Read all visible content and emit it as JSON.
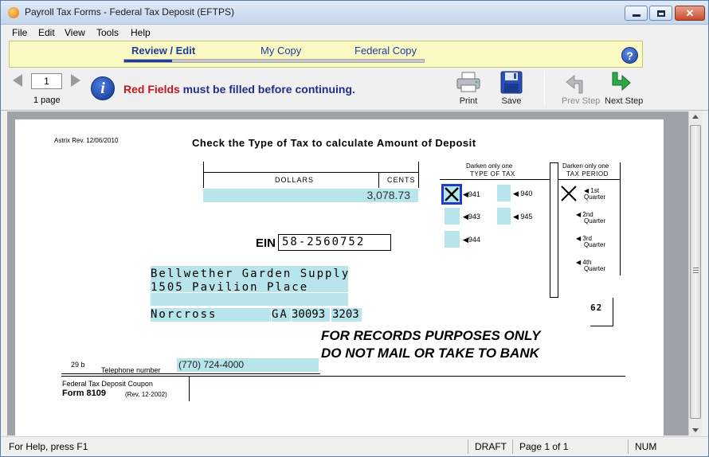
{
  "window": {
    "title": "Payroll Tax Forms - Federal Tax Deposit (EFTPS)",
    "minimize_glyph": "",
    "maximize_glyph": "",
    "close_glyph": "✕"
  },
  "menu": [
    "File",
    "Edit",
    "View",
    "Tools",
    "Help"
  ],
  "banner": {
    "tabs": [
      "Review / Edit",
      "My Copy",
      "Federal Copy"
    ],
    "active_tab": 0,
    "progress_fraction": 0.16,
    "help_glyph": "?"
  },
  "toolbar": {
    "page_number": "1",
    "page_count": "1 page",
    "message_red": "Red Fields",
    "message_rest": " must be filled before continuing.",
    "print_label": "Print",
    "save_label": "Save",
    "prev_label": "Prev Step",
    "next_label": "Next Step"
  },
  "form": {
    "revision": "Astrix  Rev. 12/06/2010",
    "heading": "Check the Type of Tax to calculate Amount of Deposit",
    "dollars_label": "DOLLARS",
    "cents_label": "CENTS",
    "amount": "3,078.73",
    "ein_label": "EIN",
    "ein_value": "58-2560752",
    "address_line1": "Bellwether Garden Supply",
    "address_line2": "1505 Pavilion Place",
    "city": "Norcross",
    "state": "GA",
    "zip_part1": "30093",
    "zip_part2": "3203",
    "notice_line1": "FOR RECORDS PURPOSES ONLY",
    "notice_line2": "DO NOT MAIL OR TAKE TO BANK",
    "type_header_line1": "Darken  only one",
    "type_header_line2": "TYPE OF TAX",
    "tax_types": [
      "941",
      "943",
      "944",
      "940",
      "945"
    ],
    "tax_type_selected": "941",
    "period_header_line1": "Darken  only one",
    "period_header_line2": "TAX PERIOD",
    "periods": [
      {
        "num": "1st",
        "label": "Quarter"
      },
      {
        "num": "2nd",
        "label": "Quarter"
      },
      {
        "num": "3rd",
        "label": "Quarter"
      },
      {
        "num": "4th",
        "label": "Quarter"
      }
    ],
    "period_selected": "1st",
    "corner_code": "62",
    "phone_code": "29  b",
    "phone_label": "Telephone number",
    "phone_value": "(770) 724-4000",
    "coupon_title": "Federal  Tax  Deposit  Coupon",
    "coupon_form": "Form  8109",
    "coupon_rev": "(Rev. 12-2002)"
  },
  "status": {
    "help": "For Help, press F1",
    "mode": "DRAFT",
    "page": "Page 1 of 1",
    "num": "NUM"
  },
  "colors": {
    "fill_field": "#b8e4ec",
    "required_text": "#c41818",
    "banner_bg": "#fbf9c3",
    "selected_box": "#1f3cc8"
  }
}
